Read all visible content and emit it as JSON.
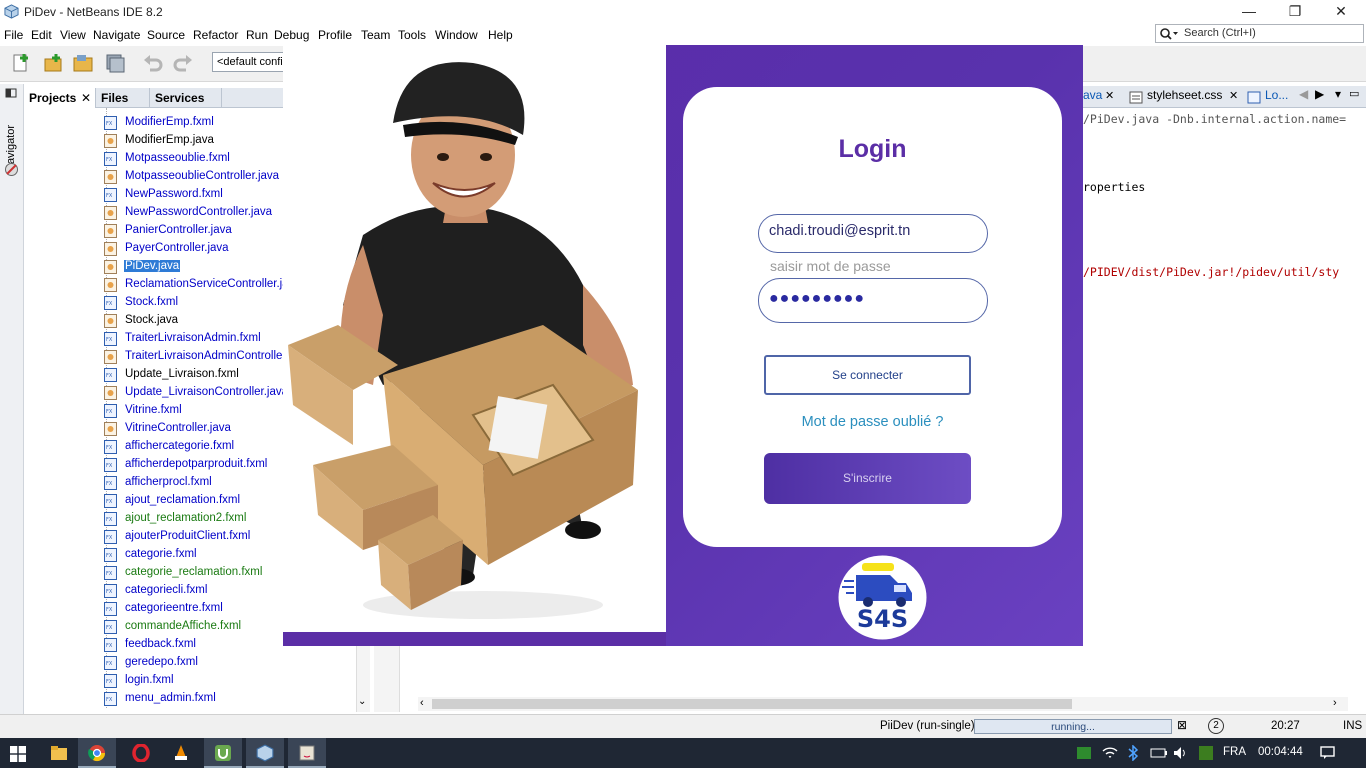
{
  "window": {
    "title": "PiDev - NetBeans IDE 8.2",
    "minimize": "—",
    "restore": "❐",
    "close": "✕"
  },
  "menu": [
    "File",
    "Edit",
    "View",
    "Navigate",
    "Source",
    "Refactor",
    "Run",
    "Debug",
    "Profile",
    "Team",
    "Tools",
    "Window",
    "Help"
  ],
  "search": {
    "placeholder": "Search (Ctrl+I)"
  },
  "toolbar": {
    "config": "<default confi"
  },
  "sidebar": {
    "navigator_label": "Navigator"
  },
  "panel_tabs": [
    "Projects",
    "Files",
    "Services"
  ],
  "files": [
    {
      "name": "ModifierEmp.fxml",
      "kind": "fxml",
      "color": "blue"
    },
    {
      "name": "ModifierEmp.java",
      "kind": "java",
      "color": "black"
    },
    {
      "name": "Motpasseoublie.fxml",
      "kind": "fxml",
      "color": "blue"
    },
    {
      "name": "MotpasseoublieController.java",
      "kind": "java",
      "color": "blue"
    },
    {
      "name": "NewPassword.fxml",
      "kind": "fxml",
      "color": "blue"
    },
    {
      "name": "NewPasswordController.java",
      "kind": "java",
      "color": "blue"
    },
    {
      "name": "PanierController.java",
      "kind": "java",
      "color": "blue"
    },
    {
      "name": "PayerController.java",
      "kind": "java",
      "color": "blue"
    },
    {
      "name": "PiDev.java",
      "kind": "java",
      "color": "selected"
    },
    {
      "name": "ReclamationServiceController.java",
      "kind": "java",
      "color": "blue"
    },
    {
      "name": "Stock.fxml",
      "kind": "fxml",
      "color": "blue"
    },
    {
      "name": "Stock.java",
      "kind": "java",
      "color": "black"
    },
    {
      "name": "TraiterLivraisonAdmin.fxml",
      "kind": "fxml",
      "color": "blue"
    },
    {
      "name": "TraiterLivraisonAdminController.java",
      "kind": "java",
      "color": "blue"
    },
    {
      "name": "Update_Livraison.fxml",
      "kind": "fxml",
      "color": "black"
    },
    {
      "name": "Update_LivraisonController.java",
      "kind": "java",
      "color": "blue"
    },
    {
      "name": "Vitrine.fxml",
      "kind": "fxml",
      "color": "blue"
    },
    {
      "name": "VitrineController.java",
      "kind": "java",
      "color": "blue"
    },
    {
      "name": "affichercategorie.fxml",
      "kind": "fxml",
      "color": "blue"
    },
    {
      "name": "afficherdepotparproduit.fxml",
      "kind": "fxml",
      "color": "blue"
    },
    {
      "name": "afficherprocl.fxml",
      "kind": "fxml",
      "color": "blue"
    },
    {
      "name": "ajout_reclamation.fxml",
      "kind": "fxml",
      "color": "blue"
    },
    {
      "name": "ajout_reclamation2.fxml",
      "kind": "fxml",
      "color": "green"
    },
    {
      "name": "ajouterProduitClient.fxml",
      "kind": "fxml",
      "color": "blue"
    },
    {
      "name": "categorie.fxml",
      "kind": "fxml",
      "color": "blue"
    },
    {
      "name": "categorie_reclamation.fxml",
      "kind": "fxml",
      "color": "green"
    },
    {
      "name": "categoriecli.fxml",
      "kind": "fxml",
      "color": "blue"
    },
    {
      "name": "categorieentre.fxml",
      "kind": "fxml",
      "color": "blue"
    },
    {
      "name": "commandeAffiche.fxml",
      "kind": "fxml",
      "color": "green"
    },
    {
      "name": "feedback.fxml",
      "kind": "fxml",
      "color": "blue"
    },
    {
      "name": "geredepo.fxml",
      "kind": "fxml",
      "color": "blue"
    },
    {
      "name": "login.fxml",
      "kind": "fxml",
      "color": "blue"
    },
    {
      "name": "menu_admin.fxml",
      "kind": "fxml",
      "color": "blue"
    }
  ],
  "editor_tabs": [
    "ava",
    "stylehseet.css",
    "Lo..."
  ],
  "output_lines": [
    {
      "text": "/PiDev.java -Dnb.internal.action.name=",
      "color": "grey"
    },
    {
      "text": "roperties",
      "color": "black"
    },
    {
      "text": "/PIDEV/dist/PiDev.jar!/pidev/util/sty",
      "color": "red"
    }
  ],
  "status": {
    "project": "PiiDev (run-single)",
    "progress_text": "running...",
    "notifications": "2",
    "time": "20:27",
    "mode": "INS"
  },
  "taskbar": {
    "lang": "FRA",
    "clock": "00:04:44"
  },
  "login": {
    "title": "Login",
    "email_value": "chadi.troudi@esprit.tn",
    "password_label": "saisir mot de passe",
    "password_value": "●●●●●●●●●",
    "connect_button": "Se connecter",
    "forgot_link": "Mot de passe oublié ?",
    "signup_button": "S'inscrire",
    "logo_text": "S4S"
  }
}
